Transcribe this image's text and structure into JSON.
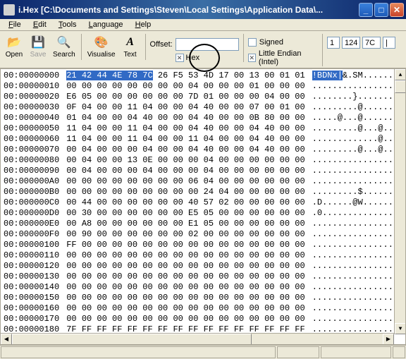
{
  "window": {
    "title": "i.Hex [C:\\Documents and Settings\\Steven\\Local Settings\\Application Data\\..."
  },
  "menu": {
    "file": "File",
    "edit": "Edit",
    "tools": "Tools",
    "language": "Language",
    "help": "Help"
  },
  "toolbar": {
    "open": "Open",
    "save": "Save",
    "search": "Search",
    "visualise": "Visualise",
    "text": "Text",
    "offset_label": "Offset:",
    "offset_value": "",
    "hex_label": "Hex",
    "signed_label": "Signed",
    "le_label": "Little Endian (Intel)",
    "num1": "1",
    "num2": "124",
    "num3": "7C",
    "num4": "|"
  },
  "rows": [
    {
      "off": "00:00000000",
      "b": "21 42 44 4E 78 7C 26 F5 53 4D 17 00 13 00 01 01",
      "a": "!BDNx|&.SM......"
    },
    {
      "off": "00:00000010",
      "b": "00 00 00 00 00 00 00 00 04 00 00 00 01 00 00 00",
      "a": "................"
    },
    {
      "off": "00:00000020",
      "b": "E6 05 00 00 00 00 00 00 7D 01 00 00 00 04 00 00",
      "a": "........}......."
    },
    {
      "off": "00:00000030",
      "b": "0F 04 00 00 11 04 00 00 04 40 00 00 07 00 01 00",
      "a": ".........@......"
    },
    {
      "off": "00:00000040",
      "b": "01 04 00 00 04 40 00 00 04 40 00 00 0B 80 00 00",
      "a": ".....@...@......"
    },
    {
      "off": "00:00000050",
      "b": "11 04 00 00 11 04 00 00 04 40 00 00 04 40 00 00",
      "a": ".........@...@.."
    },
    {
      "off": "00:00000060",
      "b": "11 04 00 00 11 04 00 00 11 04 00 00 04 40 00 00",
      "a": ".............@.."
    },
    {
      "off": "00:00000070",
      "b": "00 04 00 00 00 04 00 00 04 40 00 00 04 40 00 00",
      "a": ".........@...@.."
    },
    {
      "off": "00:00000080",
      "b": "00 04 00 00 13 0E 00 00 00 04 00 00 00 00 00 00",
      "a": "................"
    },
    {
      "off": "00:00000090",
      "b": "00 04 00 00 00 04 00 00 00 04 00 00 00 00 00 00",
      "a": "................"
    },
    {
      "off": "00:000000A0",
      "b": "00 00 00 00 00 00 00 00 06 04 00 00 00 00 00 00",
      "a": "................"
    },
    {
      "off": "00:000000B0",
      "b": "00 00 00 00 00 00 00 00 00 24 04 00 00 00 00 00",
      "a": ".........$......"
    },
    {
      "off": "00:000000C0",
      "b": "00 44 00 00 00 00 00 00 40 57 02 00 00 00 00 00",
      "a": ".D......@W......"
    },
    {
      "off": "00:000000D0",
      "b": "00 30 00 00 00 00 00 00 E5 05 00 00 00 00 00 00",
      "a": ".0.............."
    },
    {
      "off": "00:000000E0",
      "b": "00 A8 00 00 00 00 00 00 E1 05 00 00 00 00 00 00",
      "a": "................"
    },
    {
      "off": "00:000000F0",
      "b": "00 90 00 00 00 00 00 00 02 00 00 00 00 00 00 00",
      "a": "................"
    },
    {
      "off": "00:00000100",
      "b": "FF 00 00 00 00 00 00 00 00 00 00 00 00 00 00 00",
      "a": "................"
    },
    {
      "off": "00:00000110",
      "b": "00 00 00 00 00 00 00 00 00 00 00 00 00 00 00 00",
      "a": "................"
    },
    {
      "off": "00:00000120",
      "b": "00 00 00 00 00 00 00 00 00 00 00 00 00 00 00 00",
      "a": "................"
    },
    {
      "off": "00:00000130",
      "b": "00 00 00 00 00 00 00 00 00 00 00 00 00 00 00 00",
      "a": "................"
    },
    {
      "off": "00:00000140",
      "b": "00 00 00 00 00 00 00 00 00 00 00 00 00 00 00 00",
      "a": "................"
    },
    {
      "off": "00:00000150",
      "b": "00 00 00 00 00 00 00 00 00 00 00 00 00 00 00 00",
      "a": "................"
    },
    {
      "off": "00:00000160",
      "b": "00 00 00 00 00 00 00 00 00 00 00 00 00 00 00 00",
      "a": "................"
    },
    {
      "off": "00:00000170",
      "b": "00 00 00 00 00 00 00 00 00 00 00 00 00 00 00 00",
      "a": "................"
    },
    {
      "off": "00:00000180",
      "b": "7F FF FF FF FF FF FF FF FF FF FF FF FF FF FF FF",
      "a": "................"
    }
  ]
}
